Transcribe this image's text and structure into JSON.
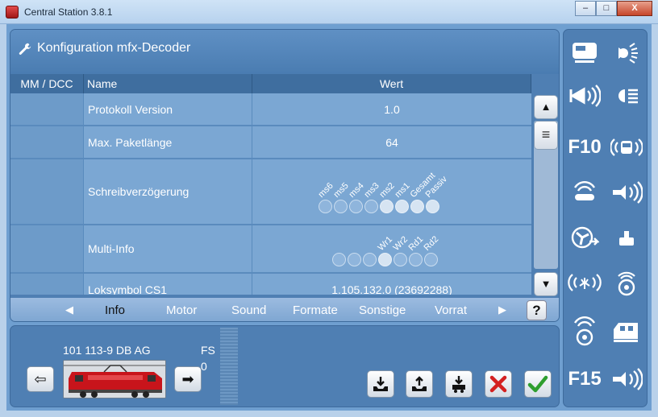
{
  "window": {
    "title": "Central Station 3.8.1",
    "min": "–",
    "max": "□",
    "close": "X"
  },
  "panel": {
    "title": "Konfiguration mfx-Decoder"
  },
  "columns": {
    "mm": "MM / DCC",
    "name": "Name",
    "wert": "Wert"
  },
  "rows": [
    {
      "name": "Protokoll Version",
      "value": "1.0"
    },
    {
      "name": "Max. Paketlänge",
      "value": "64"
    },
    {
      "name": "Schreibverzögerung",
      "bits": [
        "ms6",
        "ms5",
        "ms4",
        "ms3",
        "ms2",
        "ms1",
        "Gesamt",
        "Passiv"
      ],
      "active": [
        false,
        false,
        false,
        false,
        true,
        true,
        true,
        true
      ]
    },
    {
      "name": "Multi-Info",
      "bits": [
        "",
        "",
        "",
        "Wr1",
        "Wr2",
        "Rd1",
        "Rd2"
      ],
      "active": [
        false,
        false,
        false,
        true,
        false,
        false,
        false
      ]
    },
    {
      "name": "Loksymbol CS1",
      "value": "1.105.132.0 (23692288)"
    }
  ],
  "scroll": {
    "up": "▲",
    "thumb": "≡",
    "down": "▼"
  },
  "tabs": {
    "prev": "◀",
    "next": "▶",
    "help": "?",
    "items": [
      "Info",
      "Motor",
      "Sound",
      "Formate",
      "Sonstige",
      "Vorrat"
    ],
    "active": "Info"
  },
  "loco": {
    "name": "101 113-9 DB AG",
    "fs_label": "FS",
    "fs_value": "0",
    "prev": "⇦",
    "next": "➡"
  },
  "functions": [
    {
      "icon": "cab-light-icon"
    },
    {
      "icon": "headlight-icon"
    },
    {
      "icon": "horn-sound-icon"
    },
    {
      "icon": "high-beam-icon"
    },
    {
      "label": "F10"
    },
    {
      "icon": "vehicle-sound-icon"
    },
    {
      "icon": "whistle-icon"
    },
    {
      "icon": "horn-icon"
    },
    {
      "icon": "fan-icon"
    },
    {
      "icon": "coupler-icon"
    },
    {
      "icon": "sand-sound-icon"
    },
    {
      "icon": "brake-sound-icon"
    },
    {
      "icon": "bell-sound-icon"
    },
    {
      "icon": "wagon-icon"
    },
    {
      "label": "F15"
    },
    {
      "icon": "horn2-icon"
    }
  ],
  "colors": {
    "panel": "#4f7fb3",
    "row": "#7ba7d3",
    "ok": "#2e9e2e",
    "cancel": "#d42020"
  }
}
